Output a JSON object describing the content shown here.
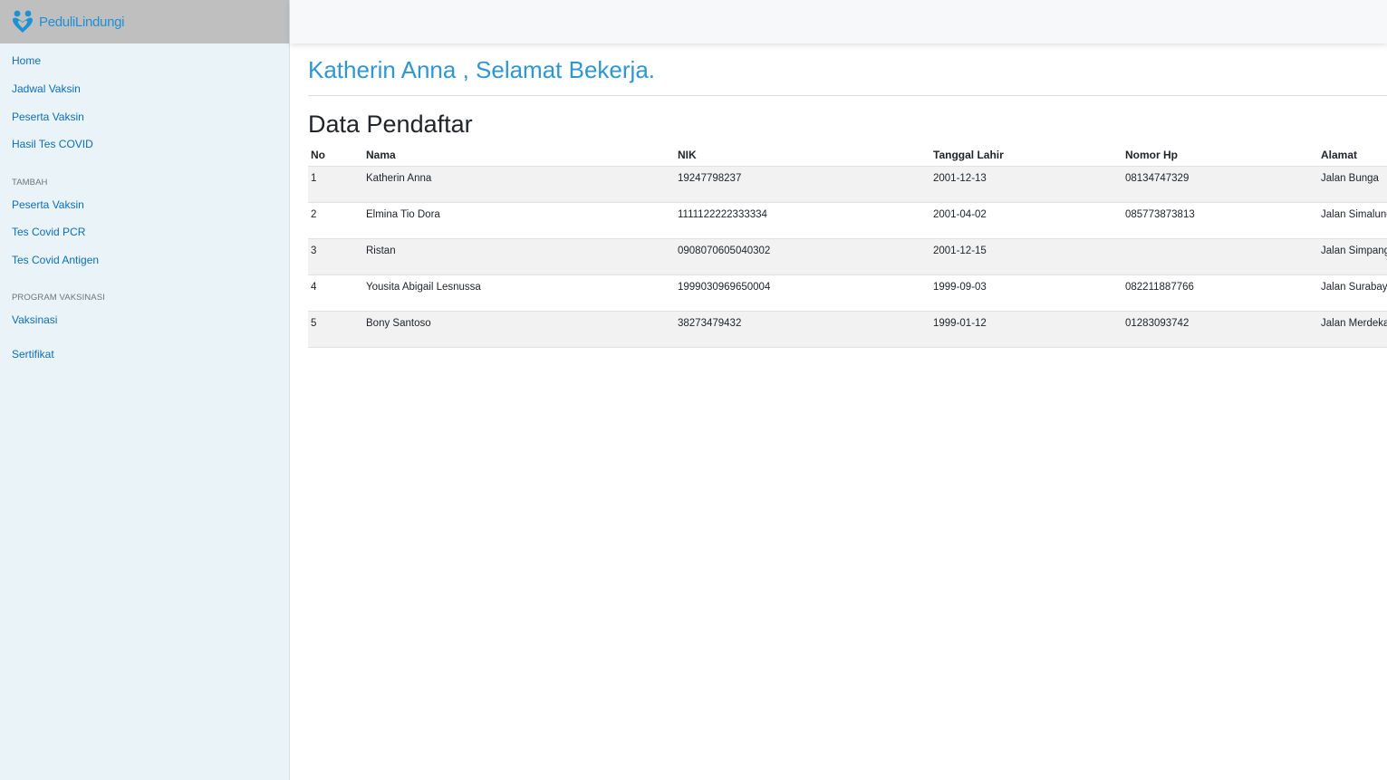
{
  "brand": {
    "name": "PeduliLindungi"
  },
  "sidebar": {
    "main_items": [
      {
        "label": "Home"
      },
      {
        "label": "Jadwal Vaksin"
      },
      {
        "label": "Peserta Vaksin"
      },
      {
        "label": "Hasil Tes COVID"
      }
    ],
    "tambah": {
      "heading": "TAMBAH",
      "items": [
        {
          "label": "Peserta Vaksin"
        },
        {
          "label": "Tes Covid PCR"
        },
        {
          "label": "Tes Covid Antigen"
        }
      ]
    },
    "program": {
      "heading": "PROGRAM VAKSINASI",
      "items": [
        {
          "label": "Vaksinasi"
        },
        {
          "label": "Sertifikat"
        }
      ]
    }
  },
  "main": {
    "greeting": "Katherin Anna , Selamat Bekerja.",
    "section_title": "Data Pendaftar",
    "table": {
      "headers": [
        "No",
        "Nama",
        "NIK",
        "Tanggal Lahir",
        "Nomor Hp",
        "Alamat"
      ],
      "rows": [
        [
          "1",
          "Katherin Anna",
          "19247798237",
          "2001-12-13",
          "08134747329",
          "Jalan Bunga"
        ],
        [
          "2",
          "Elmina Tio Dora",
          "1111122222333334",
          "2001-04-02",
          "085773873813",
          "Jalan Simalungun"
        ],
        [
          "3",
          "Ristan",
          "0908070605040302",
          "2001-12-15",
          "",
          "Jalan Simpang"
        ],
        [
          "4",
          "Yousita Abigail Lesnussa",
          "1999030969650004",
          "1999-09-03",
          "082211887766",
          "Jalan Surabaya"
        ],
        [
          "5",
          "Bony Santoso",
          "38273479432",
          "1999-01-12",
          "01283093742",
          "Jalan Merdeka"
        ]
      ]
    }
  },
  "colors": {
    "accent": "#2f96cf",
    "link": "#0d6eb8",
    "sidebar_bg": "#e9f3f8",
    "brand_bg": "#bfbfbf"
  }
}
